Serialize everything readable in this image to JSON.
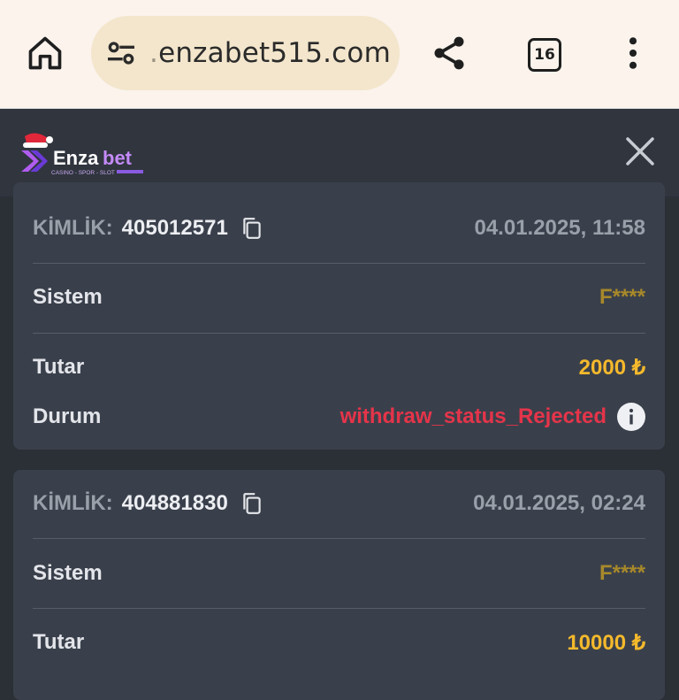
{
  "browser": {
    "url_prefix": ".",
    "url_main": "enzabet515.com",
    "tab_count": "16"
  },
  "site": {
    "logo_text_pre": "Enza",
    "logo_text_post": "bet",
    "logo_tagline": "CASINO - SPOR - SLOT"
  },
  "transactions": [
    {
      "id_label": "KİMLİK:",
      "id": "405012571",
      "datetime": "04.01.2025, 11:58",
      "system_label": "Sistem",
      "system": "F****",
      "amount_label": "Tutar",
      "amount": "2000 ₺",
      "status_label": "Durum",
      "status": "withdraw_status_Rejected"
    },
    {
      "id_label": "KİMLİK:",
      "id": "404881830",
      "datetime": "04.01.2025, 02:24",
      "system_label": "Sistem",
      "system": "F****",
      "amount_label": "Tutar",
      "amount": "10000 ₺"
    }
  ],
  "colors": {
    "amount": "#f5b92c",
    "status_rejected": "#e5344a",
    "masked": "#a8892a"
  }
}
